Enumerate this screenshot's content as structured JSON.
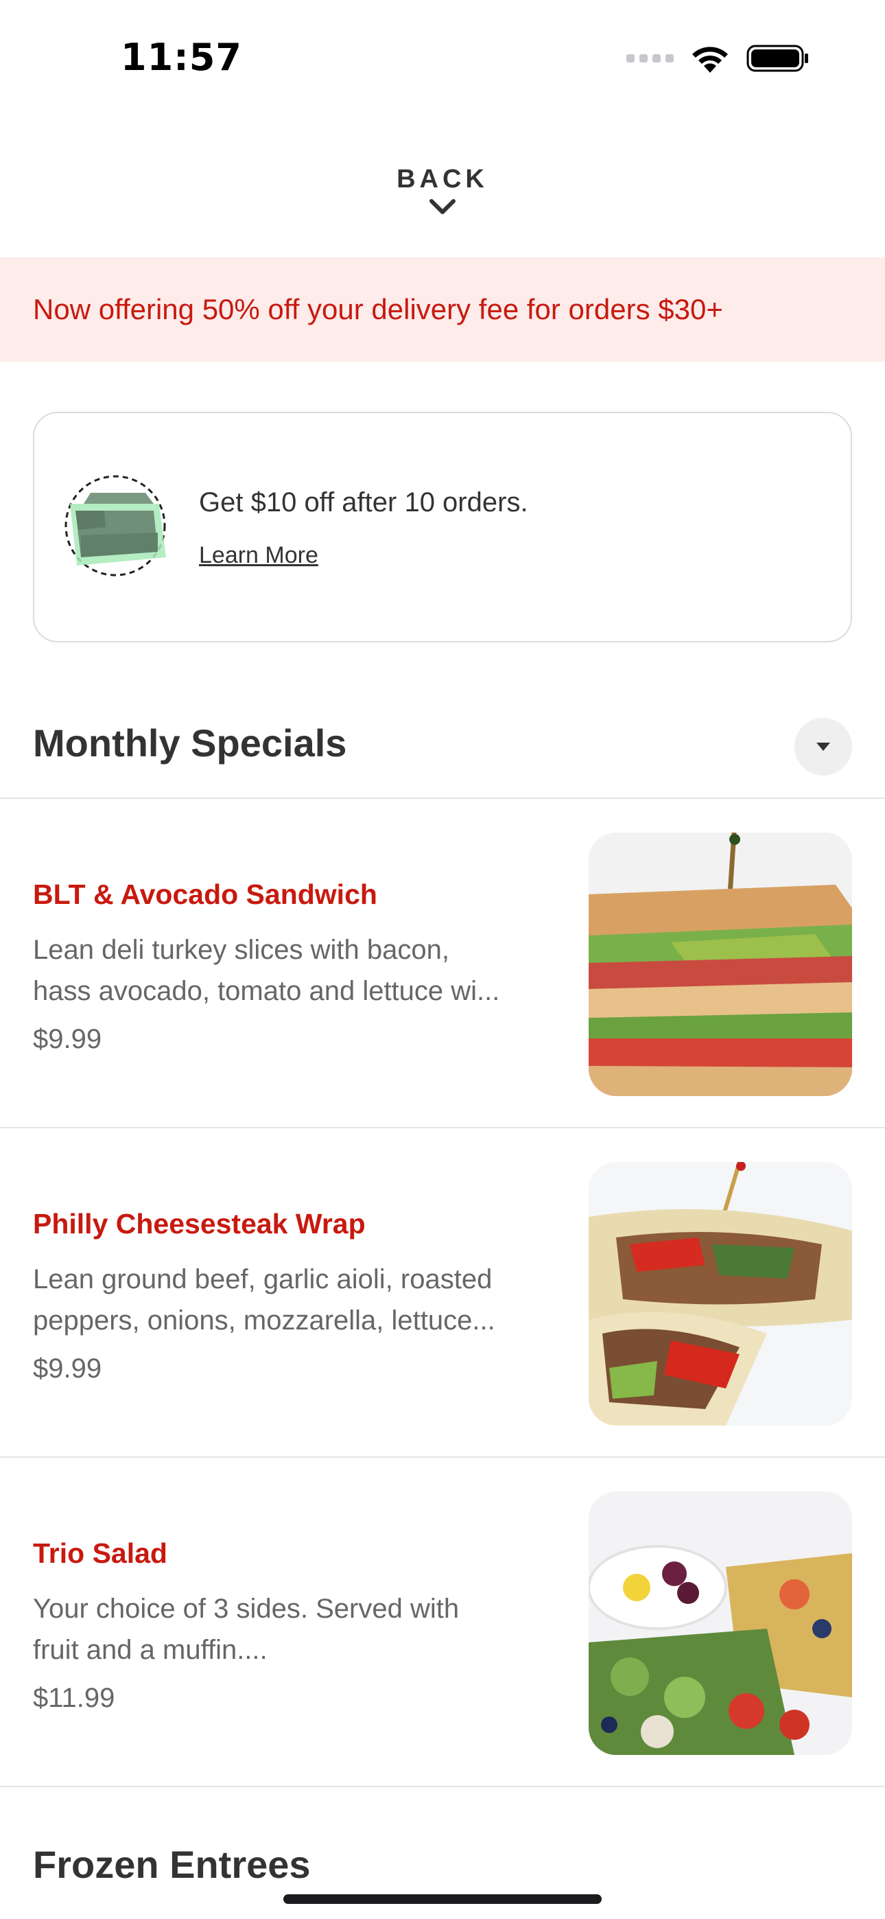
{
  "status_bar": {
    "time": "11:57"
  },
  "nav": {
    "back_label": "BACK"
  },
  "promo_banner": {
    "text": "Now offering 50% off your delivery fee for orders $30+"
  },
  "rewards_card": {
    "title": "Get $10 off after 10 orders.",
    "link_label": "Learn More",
    "icon": "bowl-icon"
  },
  "sections": [
    {
      "title": "Monthly Specials",
      "items": [
        {
          "name": "BLT & Avocado Sandwich",
          "desc_line1": "Lean deli turkey slices with bacon,",
          "desc_line2": "hass avocado, tomato and lettuce wi...",
          "price": "$9.99",
          "image_icon": "sandwich-image"
        },
        {
          "name": "Philly Cheesesteak Wrap",
          "desc_line1": "Lean ground beef, garlic aioli, roasted",
          "desc_line2": "peppers, onions, mozzarella, lettuce...",
          "price": "$9.99",
          "image_icon": "wrap-image"
        },
        {
          "name": "Trio Salad",
          "desc_line1": "Your choice of 3 sides. Served with",
          "desc_line2": "fruit and a muffin....",
          "price": "$11.99",
          "image_icon": "salad-image"
        }
      ]
    },
    {
      "title": "Frozen Entrees"
    }
  ],
  "colors": {
    "accent_red": "#c8190f",
    "banner_bg": "#fdecea",
    "text_dark": "#333333",
    "text_muted": "#666666"
  }
}
